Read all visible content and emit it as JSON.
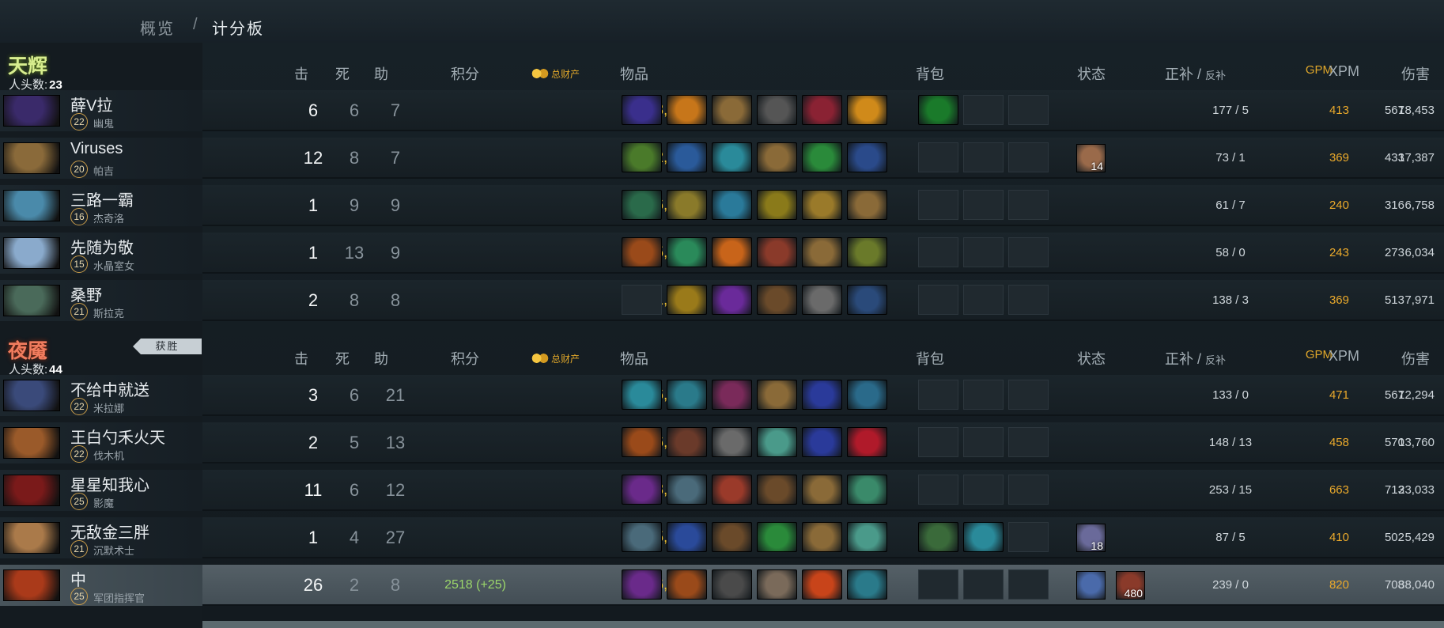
{
  "breadcrumb": {
    "overview": "概览",
    "separator": "/",
    "current": "计分板"
  },
  "headers": {
    "kills": "击",
    "deaths": "死",
    "assists": "助",
    "score": "积分",
    "networth": "总财产",
    "items": "物品",
    "backpack": "背包",
    "status": "状态",
    "last_hits": "正补",
    "lh_sep": "/",
    "denies": "反补",
    "gpm": "GPM",
    "xpm": "XPM",
    "damage": "伤害"
  },
  "radiant": {
    "name": "天辉",
    "kills_label": "人头数:",
    "kills": "23",
    "players": [
      {
        "name": "薛V拉",
        "level": "22",
        "hero": "幽鬼",
        "k": "6",
        "d": "6",
        "a": "7",
        "score": "",
        "networth": "13,684",
        "lh": "177",
        "dn": "5",
        "gpm": "413",
        "xpm": "567",
        "damage": "18,453",
        "items": [
          "#3a2f8c",
          "#c7761a",
          "#8a6a38",
          "#555555",
          "#8a2233",
          "#d08a1a"
        ],
        "backpack": [
          "#1a7a2a",
          "",
          ""
        ],
        "buffs": []
      },
      {
        "name": "Viruses",
        "level": "20",
        "hero": "帕吉",
        "k": "12",
        "d": "8",
        "a": "7",
        "score": "",
        "networth": "12,193",
        "lh": "73",
        "dn": "1",
        "gpm": "369",
        "xpm": "433",
        "damage": "17,387",
        "items": [
          "#4a7a2a",
          "#2a5a9a",
          "#2a8a9a",
          "#8a6a38",
          "#2a8a3a",
          "#2a4a8a"
        ],
        "backpack": [
          "",
          "",
          ""
        ],
        "buffs": [
          {
            "color": "#9a6a4a",
            "text": "14"
          }
        ]
      },
      {
        "name": "三路一霸",
        "level": "16",
        "hero": "杰奇洛",
        "k": "1",
        "d": "9",
        "a": "9",
        "score": "",
        "networth": "6,136",
        "lh": "61",
        "dn": "7",
        "gpm": "240",
        "xpm": "316",
        "damage": "6,758",
        "items": [
          "#2a6a4a",
          "#8a7a2a",
          "#2a7a9a",
          "#8a7a1a",
          "#9a7a2a",
          "#8a6a38"
        ],
        "backpack": [
          "",
          "",
          ""
        ],
        "buffs": []
      },
      {
        "name": "先随为敬",
        "level": "15",
        "hero": "水晶室女",
        "k": "1",
        "d": "13",
        "a": "9",
        "score": "",
        "networth": "5,941",
        "lh": "58",
        "dn": "0",
        "gpm": "243",
        "xpm": "273",
        "damage": "6,034",
        "items": [
          "#9a4a1a",
          "#2a8a5a",
          "#c8641a",
          "#8a3a2a",
          "#8a6a38",
          "#6a7a2a"
        ],
        "backpack": [
          "",
          "",
          ""
        ],
        "buffs": []
      },
      {
        "name": "桑野",
        "level": "21",
        "hero": "斯拉克",
        "k": "2",
        "d": "8",
        "a": "8",
        "score": "",
        "networth": "11,730",
        "lh": "138",
        "dn": "3",
        "gpm": "369",
        "xpm": "513",
        "damage": "7,971",
        "items": [
          "",
          "#9a7a1a",
          "#6a2a9a",
          "#6a4a2a",
          "#6a6a6a",
          "#2a4a7a"
        ],
        "backpack": [
          "",
          "",
          ""
        ],
        "buffs": []
      }
    ]
  },
  "dire": {
    "name": "夜魇",
    "kills_label": "人头数:",
    "kills": "44",
    "win_label": "获胜",
    "players": [
      {
        "name": "不给中就送",
        "level": "22",
        "hero": "米拉娜",
        "k": "3",
        "d": "6",
        "a": "21",
        "score": "",
        "networth": "16,561",
        "lh": "133",
        "dn": "0",
        "gpm": "471",
        "xpm": "567",
        "damage": "12,294",
        "items": [
          "#2a8a9a",
          "#2a7a8a",
          "#7a2a5a",
          "#8a6a38",
          "#2a3a9a",
          "#2a6a8a"
        ],
        "backpack": [
          "",
          "",
          ""
        ],
        "buffs": []
      },
      {
        "name": "王白勺禾火天",
        "level": "22",
        "hero": "伐木机",
        "k": "2",
        "d": "5",
        "a": "13",
        "score": "",
        "networth": "16,492",
        "lh": "148",
        "dn": "13",
        "gpm": "458",
        "xpm": "570",
        "damage": "13,760",
        "items": [
          "#9a4a1a",
          "#6a3a2a",
          "#6a6a6a",
          "#4a9a8a",
          "#2a3a9a",
          "#b01a2a"
        ],
        "backpack": [
          "",
          "",
          ""
        ],
        "buffs": []
      },
      {
        "name": "星星知我心",
        "level": "25",
        "hero": "影魔",
        "k": "11",
        "d": "6",
        "a": "12",
        "score": "",
        "networth": "23,885",
        "lh": "253",
        "dn": "15",
        "gpm": "663",
        "xpm": "713",
        "damage": "23,033",
        "items": [
          "#6a2a8a",
          "#4a6a7a",
          "#9a3a2a",
          "#6a4a2a",
          "#8a6a38",
          "#3a8a6a"
        ],
        "backpack": [
          "",
          "",
          ""
        ],
        "buffs": []
      },
      {
        "name": "无敌金三胖",
        "level": "21",
        "hero": "沉默术士",
        "k": "1",
        "d": "4",
        "a": "27",
        "score": "",
        "networth": "15,161",
        "lh": "87",
        "dn": "5",
        "gpm": "410",
        "xpm": "502",
        "damage": "5,429",
        "items": [
          "#4a6a7a",
          "#2a4a9a",
          "#6a4a2a",
          "#2a8a3a",
          "#8a6a38",
          "#4a9a8a"
        ],
        "backpack": [
          "#3a6a3a",
          "#2a8a9a",
          ""
        ],
        "buffs": [
          {
            "color": "#6a6a9a",
            "text": "18"
          }
        ]
      },
      {
        "name": "中",
        "level": "25",
        "hero": "军团指挥官",
        "k": "26",
        "d": "2",
        "a": "8",
        "score": "2518 (+25)",
        "networth": "26,649",
        "lh": "239",
        "dn": "0",
        "gpm": "820",
        "xpm": "708",
        "damage": "38,040",
        "items": [
          "#6a2a8a",
          "#9a4a1a",
          "#4a4a4a",
          "#7a6a5a",
          "#c8441a",
          "#2a7a8a"
        ],
        "backpack": [
          "",
          "",
          ""
        ],
        "buffs": [
          {
            "color": "#4a6aaa",
            "text": ""
          },
          {
            "color": "#8a3a2a",
            "text": "480"
          }
        ]
      }
    ]
  },
  "portrait_colors": {
    "radiant": [
      "#3a2a6a",
      "#8a6a3a",
      "#4a8aaa",
      "#8aaacc",
      "#4a6a5a"
    ],
    "dire": [
      "#3a4a7a",
      "#9a5a2a",
      "#7a1a1a",
      "#aa7a4a",
      "#aa3a1a"
    ]
  }
}
